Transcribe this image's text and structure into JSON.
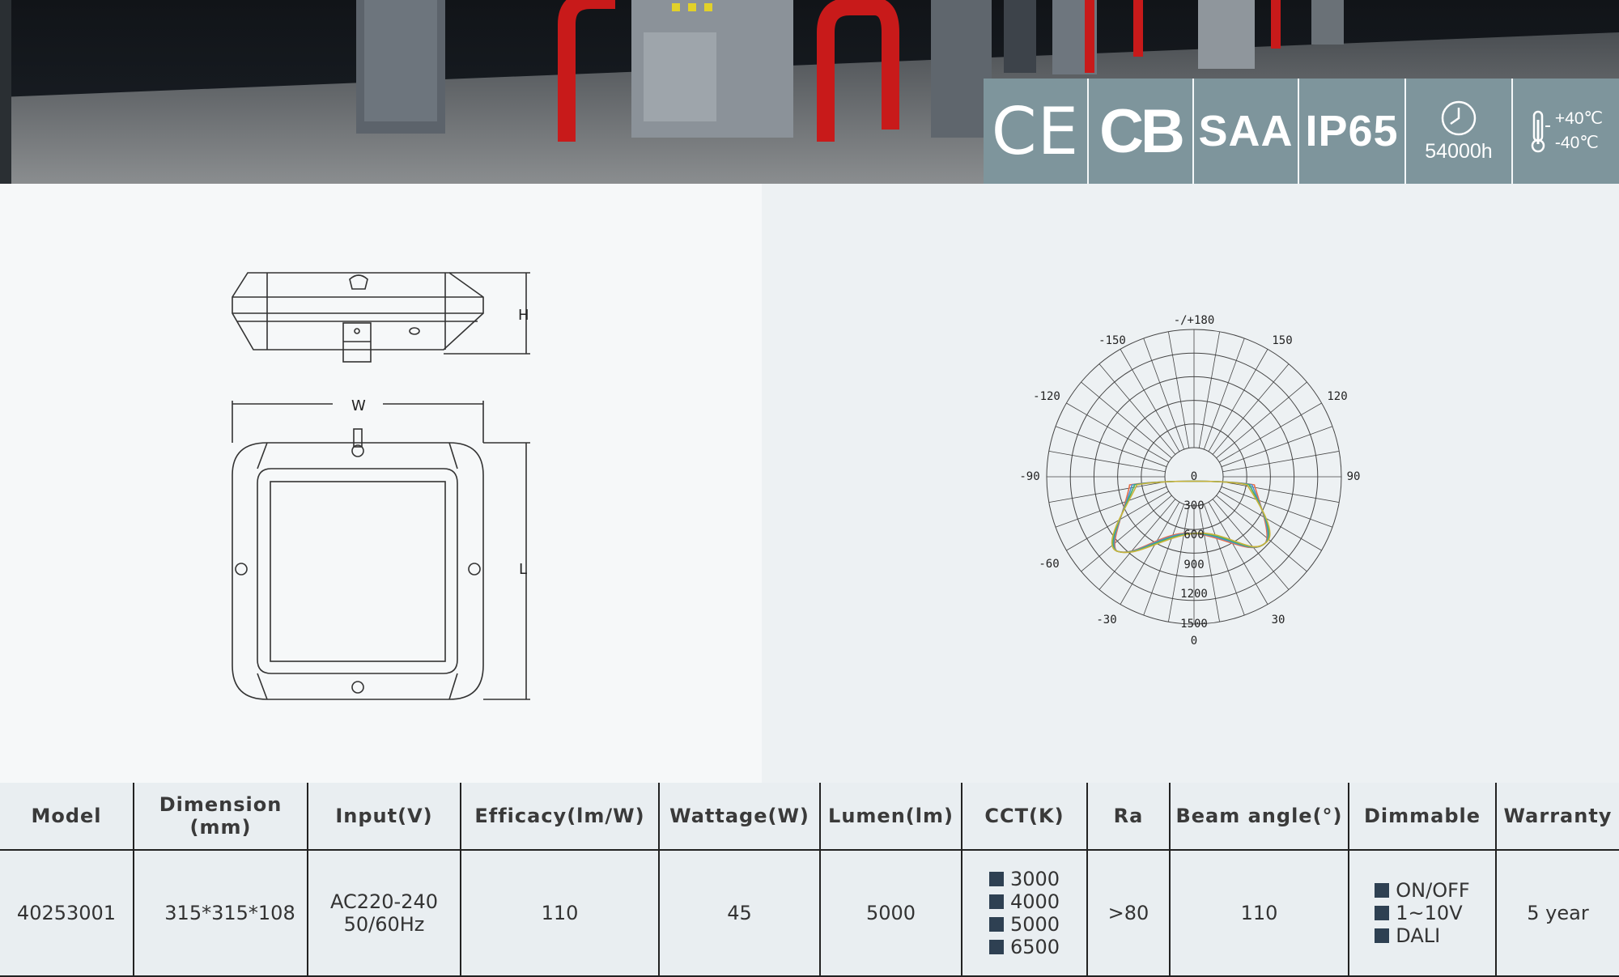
{
  "certifications": [
    {
      "name": "ce-mark",
      "label": "CE"
    },
    {
      "name": "cb-mark",
      "label": "CB"
    },
    {
      "name": "saa-mark",
      "label": "SAA"
    },
    {
      "name": "ip-rating",
      "label": "IP65"
    },
    {
      "name": "lifetime",
      "label": "54000h",
      "icon": "clock-icon"
    },
    {
      "name": "temperature",
      "high": "+40℃",
      "low": "-40℃",
      "icon": "thermometer-icon"
    }
  ],
  "drawing": {
    "height_label": "H",
    "width_label": "W",
    "length_label": "L"
  },
  "polar": {
    "angle_labels": [
      {
        "key": "top",
        "text": "-/+180"
      },
      {
        "key": "m150",
        "text": "-150"
      },
      {
        "key": "p150",
        "text": "150"
      },
      {
        "key": "m120",
        "text": "-120"
      },
      {
        "key": "p120",
        "text": "120"
      },
      {
        "key": "m90",
        "text": "-90"
      },
      {
        "key": "p90",
        "text": "90"
      },
      {
        "key": "m60",
        "text": "-60"
      },
      {
        "key": "m30",
        "text": "-30"
      },
      {
        "key": "p30",
        "text": "30"
      },
      {
        "key": "bottom",
        "text": "0"
      }
    ],
    "radial_labels": [
      "0",
      "300",
      "600",
      "900",
      "1200",
      "1500"
    ],
    "curve_colors": [
      "#e8704a",
      "#4c8fd1",
      "#3fae6a",
      "#c9b23a"
    ]
  },
  "table": {
    "headers": {
      "model": "Model",
      "dimension_1": "Dimension",
      "dimension_2": "(mm)",
      "input": "Input(V)",
      "efficacy": "Efficacy(lm/W)",
      "wattage": "Wattage(W)",
      "lumen": "Lumen(lm)",
      "cct": "CCT(K)",
      "ra": "Ra",
      "beam": "Beam angle(°)",
      "dimmable": "Dimmable",
      "warranty": "Warranty"
    },
    "row": {
      "model": "40253001",
      "dimension": "315*315*108",
      "input_1": "AC220-240",
      "input_2": "50/60Hz",
      "efficacy": "110",
      "wattage": "45",
      "lumen": "5000",
      "cct": [
        "3000",
        "4000",
        "5000",
        "6500"
      ],
      "ra": ">80",
      "beam": "110",
      "dimmable": [
        "ON/OFF",
        "1~10V",
        "DALI"
      ],
      "warranty": "5 year"
    }
  }
}
